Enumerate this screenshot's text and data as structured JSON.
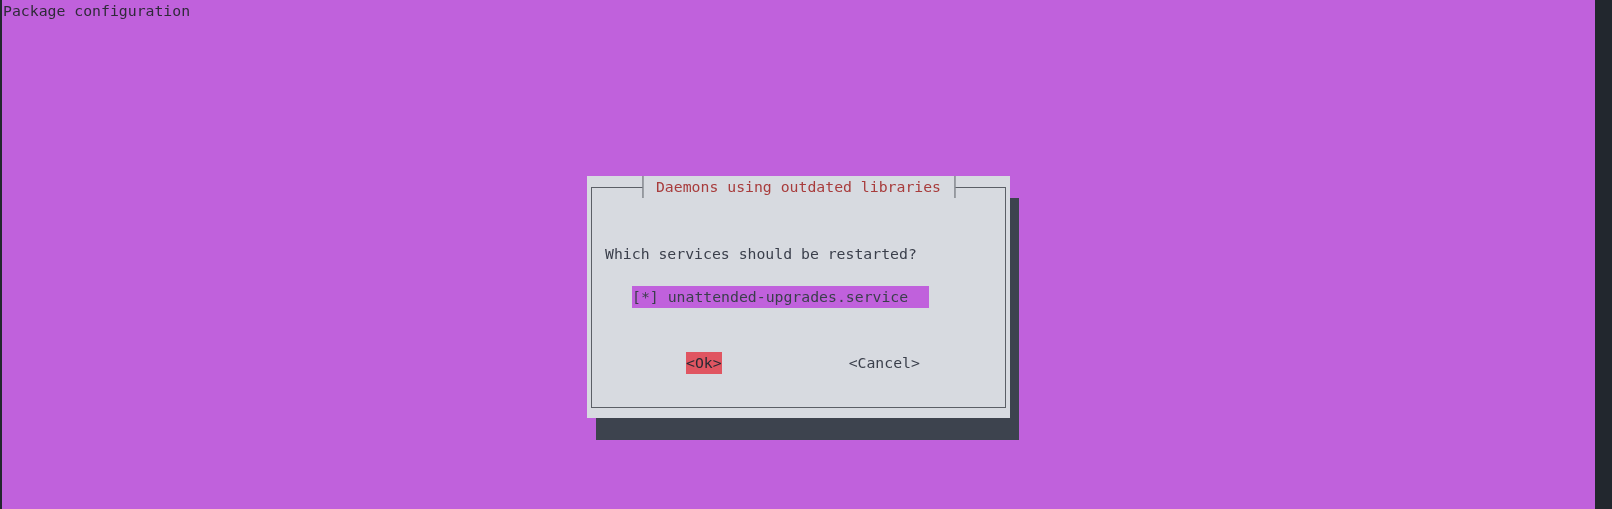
{
  "screen": {
    "title": "Package configuration"
  },
  "dialog": {
    "title": "Daemons using outdated libraries",
    "question": "Which services should be restarted?",
    "items": [
      {
        "checkbox": "[*]",
        "label": "unattended-upgrades.service",
        "selected": true
      }
    ],
    "buttons": [
      {
        "label": "<Ok>",
        "selected": true
      },
      {
        "label": "<Cancel>",
        "selected": false
      }
    ]
  }
}
